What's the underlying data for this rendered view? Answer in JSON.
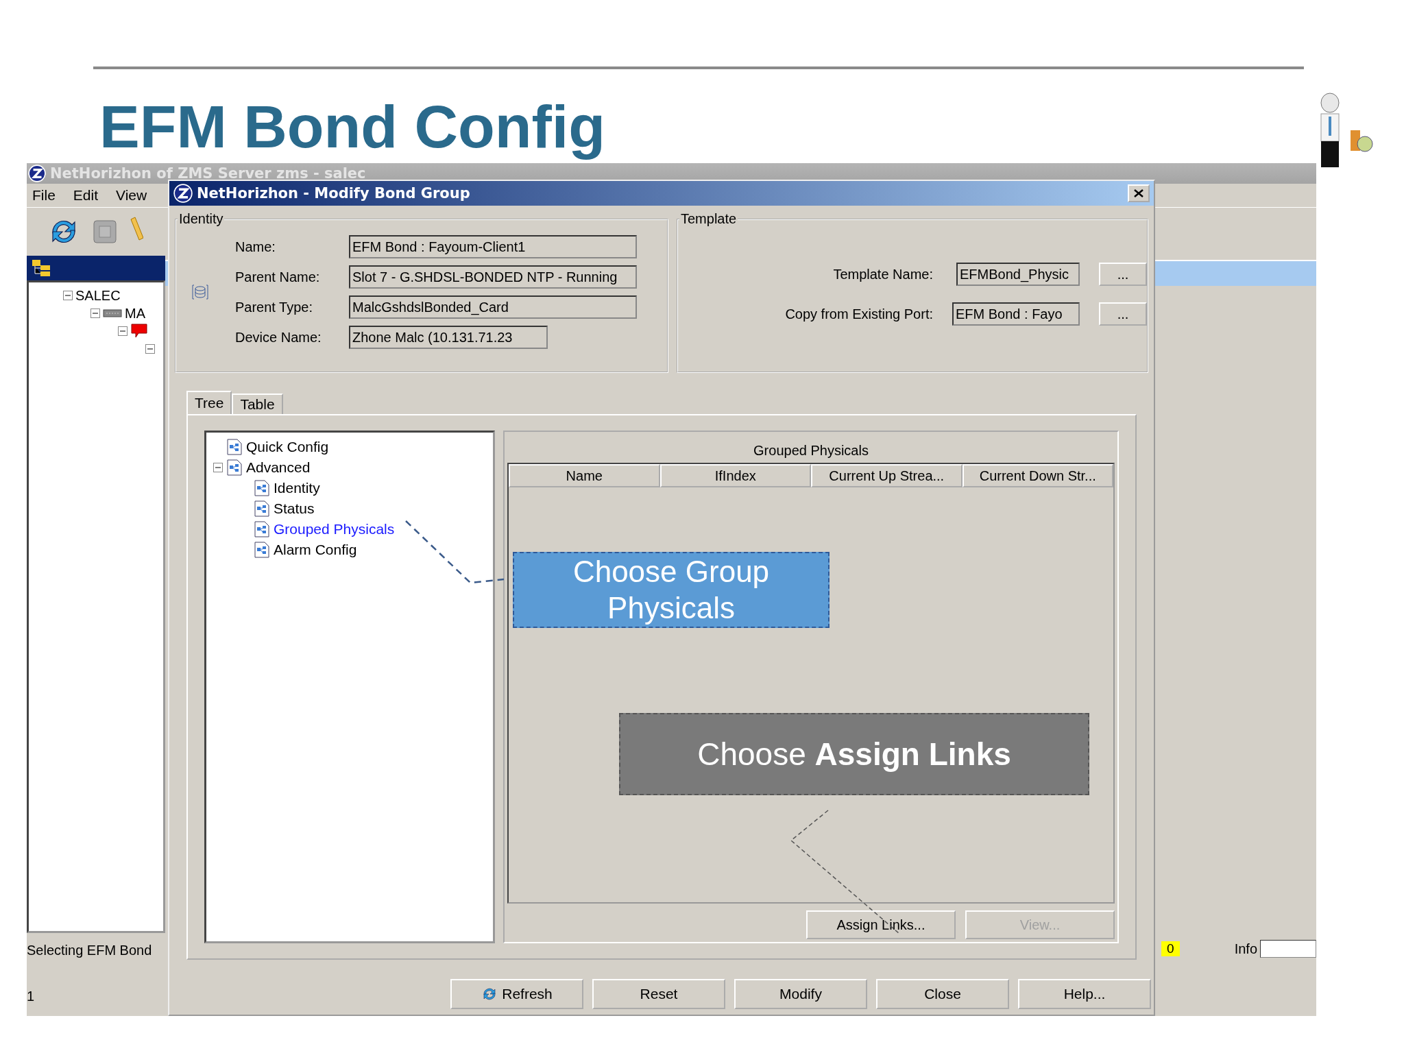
{
  "slide": {
    "title": "EFM Bond Config"
  },
  "main_window": {
    "title": "NetHorizhon of ZMS Server zms - salec",
    "menu": [
      "File",
      "Edit",
      "View"
    ],
    "tree": [
      {
        "label": "SALEC",
        "expanded": true,
        "children": [
          {
            "label": "MA",
            "expanded": true
          }
        ]
      }
    ],
    "status": "Selecting EFM Bond",
    "status_2": "1",
    "counter": "0",
    "info_label": "Info"
  },
  "dialog": {
    "title": "NetHorizhon - Modify Bond Group",
    "identity": {
      "legend": "Identity",
      "fields": [
        {
          "label": "Name:",
          "value": "EFM Bond : Fayoum-Client1"
        },
        {
          "label": "Parent Name:",
          "value": "Slot 7 - G.SHDSL-BONDED NTP - Running"
        },
        {
          "label": "Parent Type:",
          "value": "MalcGshdslBonded_Card"
        },
        {
          "label": "Device Name:",
          "value": "Zhone Malc (10.131.71.23"
        }
      ]
    },
    "template": {
      "legend": "Template",
      "fields": [
        {
          "label": "Template Name:",
          "value": "EFMBond_Physic",
          "button": "..."
        },
        {
          "label": "Copy from Existing Port:",
          "value": "EFM Bond : Fayo",
          "button": "..."
        }
      ]
    },
    "tabs": [
      {
        "label": "Tree",
        "selected": true
      },
      {
        "label": "Table",
        "selected": false
      }
    ],
    "tree": [
      {
        "label": "Quick Config",
        "selected": false
      },
      {
        "label": "Advanced",
        "selected": false,
        "expanded": true,
        "children": [
          {
            "label": "Identity",
            "selected": false
          },
          {
            "label": "Status",
            "selected": false
          },
          {
            "label": "Grouped Physicals",
            "selected": true
          },
          {
            "label": "Alarm Config",
            "selected": false
          }
        ]
      }
    ],
    "panel": {
      "title": "Grouped Physicals",
      "columns": [
        "Name",
        "IfIndex",
        "Current Up Strea...",
        "Current Down Str..."
      ],
      "buttons": [
        {
          "label": "Assign Links...",
          "disabled": false
        },
        {
          "label": "View...",
          "disabled": true
        }
      ]
    },
    "buttons": [
      {
        "label": "Refresh",
        "kind": "refresh"
      },
      {
        "label": "Reset",
        "kind": "plain"
      },
      {
        "label": "Modify",
        "kind": "plain"
      },
      {
        "label": "Close",
        "kind": "plain"
      },
      {
        "label": "Help...",
        "kind": "plain"
      }
    ]
  },
  "callouts": [
    {
      "text": "Choose Group Physicals",
      "kind": "blue"
    },
    {
      "text": "Choose **Assign Links**",
      "kind": "gray"
    }
  ]
}
